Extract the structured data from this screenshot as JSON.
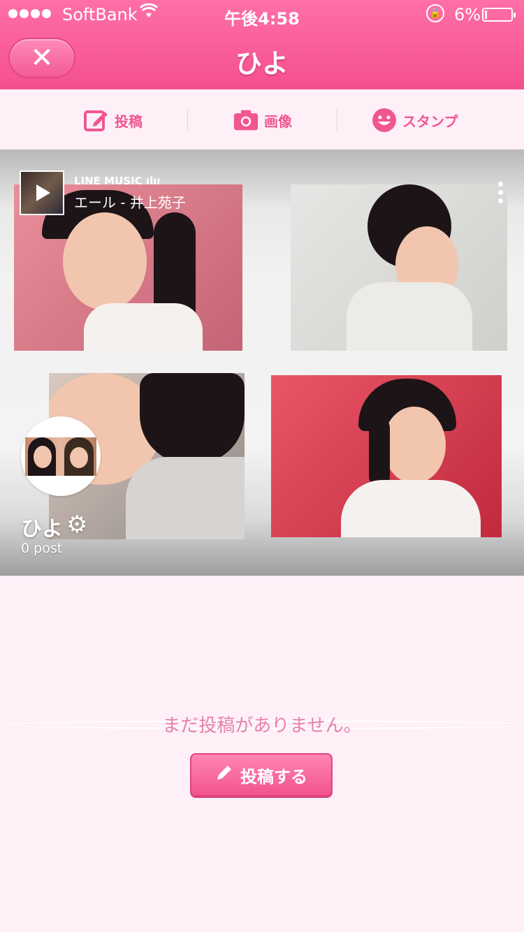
{
  "status": {
    "carrier": "SoftBank",
    "time": "午後4:58",
    "battery": "6%",
    "battery_level": 0.06
  },
  "nav": {
    "title": "ひよ"
  },
  "actions": {
    "post": "投稿",
    "image": "画像",
    "stamp": "スタンプ"
  },
  "cover": {
    "music_service": "LINE MUSIC ılıı",
    "music_track": "エール - 井上苑子",
    "profile_name": "ひよ",
    "post_count": "0 post"
  },
  "empty_state": {
    "message": "まだ投稿がありません。",
    "button_label": "投稿する"
  },
  "colors": {
    "accent": "#f35a96",
    "background": "#fff0f7",
    "text_pink": "#e782a9"
  },
  "icons": {
    "close": "close-icon",
    "post": "compose-icon",
    "image": "camera-icon",
    "stamp": "smiley-icon",
    "settings": "gear-icon",
    "more": "more-vertical-icon",
    "play": "play-icon",
    "pencil": "pencil-icon"
  }
}
